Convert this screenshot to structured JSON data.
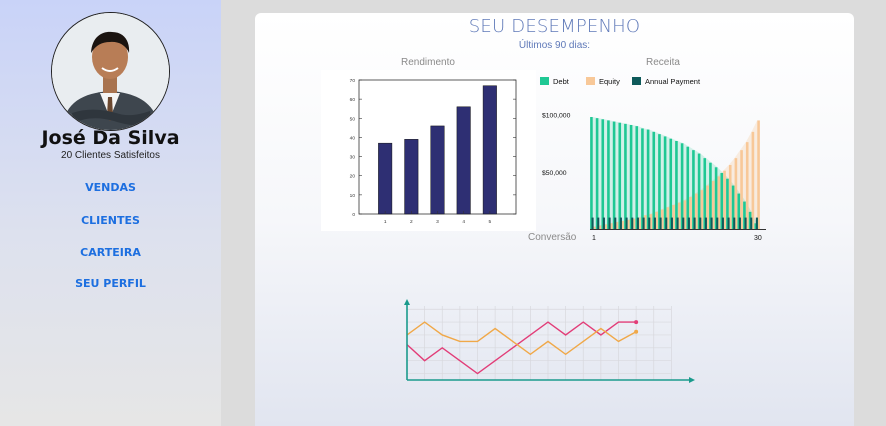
{
  "profile": {
    "name": "José Da Silva",
    "subtitle": "20 Clientes Satisfeitos",
    "avatar_icon": "person-avatar-icon"
  },
  "nav": [
    {
      "label": "VENDAS"
    },
    {
      "label": "CLIENTES"
    },
    {
      "label": "CARTEIRA"
    },
    {
      "label": "SEU PERFIL"
    }
  ],
  "main": {
    "title": "SEU DESEMPENHO",
    "subtitle": "Últimos 90 dias:"
  },
  "chart_data": [
    {
      "type": "bar",
      "title": "Rendimento",
      "categories": [
        "1",
        "2",
        "3",
        "4",
        "5"
      ],
      "values": [
        37,
        39,
        46,
        56,
        67
      ],
      "ylim": [
        0,
        70
      ],
      "yticks": [
        0,
        10,
        20,
        30,
        40,
        50,
        60,
        70
      ],
      "color": "#2e2f73"
    },
    {
      "type": "bar",
      "title": "Receita",
      "legend": [
        "Debt",
        "Equity",
        "Annual Payment"
      ],
      "colors": [
        "#1fc894",
        "#f8c898",
        "#0e5a5a"
      ],
      "ytick_labels": [
        "$100,000",
        "$50,000"
      ],
      "xtick_labels": [
        "1",
        "30"
      ],
      "x": [
        1,
        2,
        3,
        4,
        5,
        6,
        7,
        8,
        9,
        10,
        11,
        12,
        13,
        14,
        15,
        16,
        17,
        18,
        19,
        20,
        21,
        22,
        23,
        24,
        25,
        26,
        27,
        28,
        29,
        30
      ],
      "series": [
        {
          "name": "Debt",
          "values": [
            98000,
            97000,
            96000,
            95000,
            94000,
            93000,
            92000,
            91000,
            90000,
            88000,
            87000,
            85000,
            83000,
            81000,
            79000,
            77000,
            75000,
            72000,
            69000,
            66000,
            62000,
            58000,
            54000,
            49000,
            44000,
            38000,
            31000,
            24000,
            15000,
            5000
          ]
        },
        {
          "name": "Equity",
          "values": [
            2000,
            3000,
            4000,
            5000,
            6000,
            7000,
            8000,
            9000,
            10000,
            12000,
            13000,
            15000,
            17000,
            19000,
            21000,
            23000,
            25000,
            28000,
            31000,
            34000,
            38000,
            42000,
            46000,
            51000,
            56000,
            62000,
            69000,
            76000,
            85000,
            95000
          ]
        },
        {
          "name": "Annual Payment",
          "values": [
            10000,
            10000,
            10000,
            10000,
            10000,
            10000,
            10000,
            10000,
            10000,
            10000,
            10000,
            10000,
            10000,
            10000,
            10000,
            10000,
            10000,
            10000,
            10000,
            10000,
            10000,
            10000,
            10000,
            10000,
            10000,
            10000,
            10000,
            10000,
            10000,
            10000
          ]
        }
      ],
      "ylim": [
        0,
        105000
      ]
    },
    {
      "type": "line",
      "title": "Conversão",
      "x": [
        0,
        1,
        2,
        3,
        4,
        5,
        6,
        7,
        8,
        9,
        10,
        11,
        12,
        13
      ],
      "series": [
        {
          "values": [
            1.1,
            0.6,
            1.0,
            0.6,
            0.2,
            0.6,
            1.0,
            1.4,
            1.8,
            1.4,
            1.8,
            1.4,
            1.8,
            1.8
          ],
          "color": "#e23d78"
        },
        {
          "values": [
            1.4,
            1.8,
            1.4,
            1.2,
            1.2,
            1.6,
            1.2,
            0.8,
            1.2,
            0.8,
            1.2,
            1.6,
            1.2,
            1.5
          ],
          "color": "#f0a848"
        }
      ],
      "ylim": [
        0,
        2.3
      ],
      "xlim": [
        0,
        16
      ]
    }
  ]
}
